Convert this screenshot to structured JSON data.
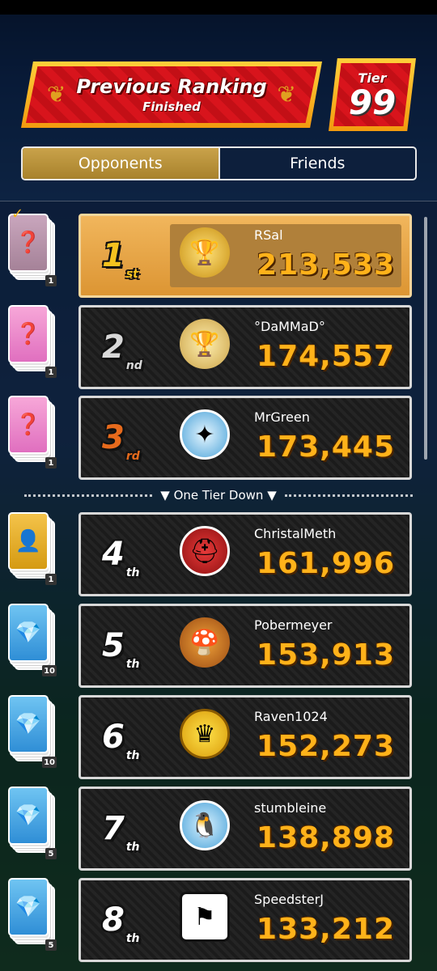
{
  "header": {
    "title": "Previous Ranking",
    "subtitle": "Finished",
    "tier_label": "Tier",
    "tier_value": "99"
  },
  "tabs": [
    {
      "label": "Opponents",
      "active": true
    },
    {
      "label": "Friends",
      "active": false
    }
  ],
  "divider_label": "▼ One Tier Down ▼",
  "rows": [
    {
      "rank": "1",
      "suffix": "st",
      "name": "RSal",
      "score": "213,533",
      "reward_count": "1",
      "emblem": "trophy-gold-icon"
    },
    {
      "rank": "2",
      "suffix": "nd",
      "name": "°DaMMaD°",
      "score": "174,557",
      "reward_count": "1",
      "emblem": "trophy-silver-icon"
    },
    {
      "rank": "3",
      "suffix": "rd",
      "name": "MrGreen",
      "score": "173,445",
      "reward_count": "1",
      "emblem": "amsterdam-sticker-icon"
    },
    {
      "rank": "4",
      "suffix": "th",
      "name": "ChristalMeth",
      "score": "161,996",
      "reward_count": "1",
      "emblem": "mario-kart-logo-icon"
    },
    {
      "rank": "5",
      "suffix": "th",
      "name": "Pobermeyer",
      "score": "153,913",
      "reward_count": "10",
      "emblem": "mushroom-icon"
    },
    {
      "rank": "6",
      "suffix": "th",
      "name": "Raven1024",
      "score": "152,273",
      "reward_count": "10",
      "emblem": "crown-icon"
    },
    {
      "rank": "7",
      "suffix": "th",
      "name": "stumbleine",
      "score": "138,898",
      "reward_count": "5",
      "emblem": "penguin-icon"
    },
    {
      "rank": "8",
      "suffix": "th",
      "name": "SpeedsterJ",
      "score": "133,212",
      "reward_count": "5",
      "emblem": "lap-2-icon"
    }
  ]
}
